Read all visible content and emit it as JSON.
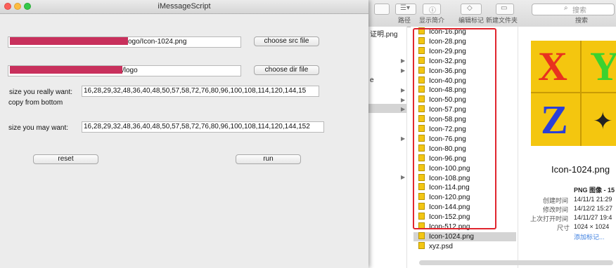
{
  "app_window": {
    "title": "iMessageScript",
    "src_field_value": "ogo/Icon-1024.png",
    "dir_field_value": "/logo",
    "choose_src_label": "choose src file",
    "choose_dir_label": "choose dir file",
    "really_want_label": "size you really want:",
    "copy_from_bottom_label": "copy from bottom",
    "really_want_value": "16,28,29,32,48,36,40,48,50,57,58,72,76,80,96,100,108,114,120,144,15",
    "may_want_label": "size you may want:",
    "may_want_value": "16,28,29,32,48,36,40,48,50,57,58,72,76,80,96,100,108,114,120,144,152",
    "reset_label": "reset",
    "run_label": "run"
  },
  "finder": {
    "toolbar": {
      "path_label": "路径",
      "show_info_label": "显示简介",
      "edit_tags_label": "编辑标记",
      "new_folder_label": "新建文件夹",
      "search_placeholder": "搜索",
      "search_label": "搜索"
    },
    "column1": {
      "items": [
        "证明.png",
        "e"
      ]
    },
    "files": [
      "Icon-16.png",
      "Icon-28.png",
      "Icon-29.png",
      "Icon-32.png",
      "Icon-36.png",
      "Icon-40.png",
      "Icon-48.png",
      "Icon-50.png",
      "Icon-57.png",
      "Icon-58.png",
      "Icon-72.png",
      "Icon-76.png",
      "Icon-80.png",
      "Icon-96.png",
      "Icon-100.png",
      "Icon-108.png",
      "Icon-114.png",
      "Icon-120.png",
      "Icon-144.png",
      "Icon-152.png",
      "Icon-512.png",
      "Icon-1024.png",
      "xyz.psd"
    ],
    "selected_file": "Icon-1024.png",
    "preview": {
      "letters": [
        "X",
        "Y",
        "Z"
      ],
      "filename": "Icon-1024.png",
      "kind": "PNG 图像 - 15",
      "created_key": "创建时间",
      "created_val": "14/11/1 21:29",
      "modified_key": "修改时间",
      "modified_val": "14/12/2 15:27",
      "opened_key": "上次打开时间",
      "opened_val": "14/11/27 19:4",
      "size_key": "尺寸",
      "size_val": "1024 × 1024",
      "add_tags": "添加标记..."
    }
  },
  "colors": {
    "redaction": "#c8305c",
    "highlight": "#e0252e",
    "folder_icon": "#f3c613",
    "close": "#fc605b",
    "minimize": "#fdbc40",
    "zoom": "#34c84a"
  }
}
